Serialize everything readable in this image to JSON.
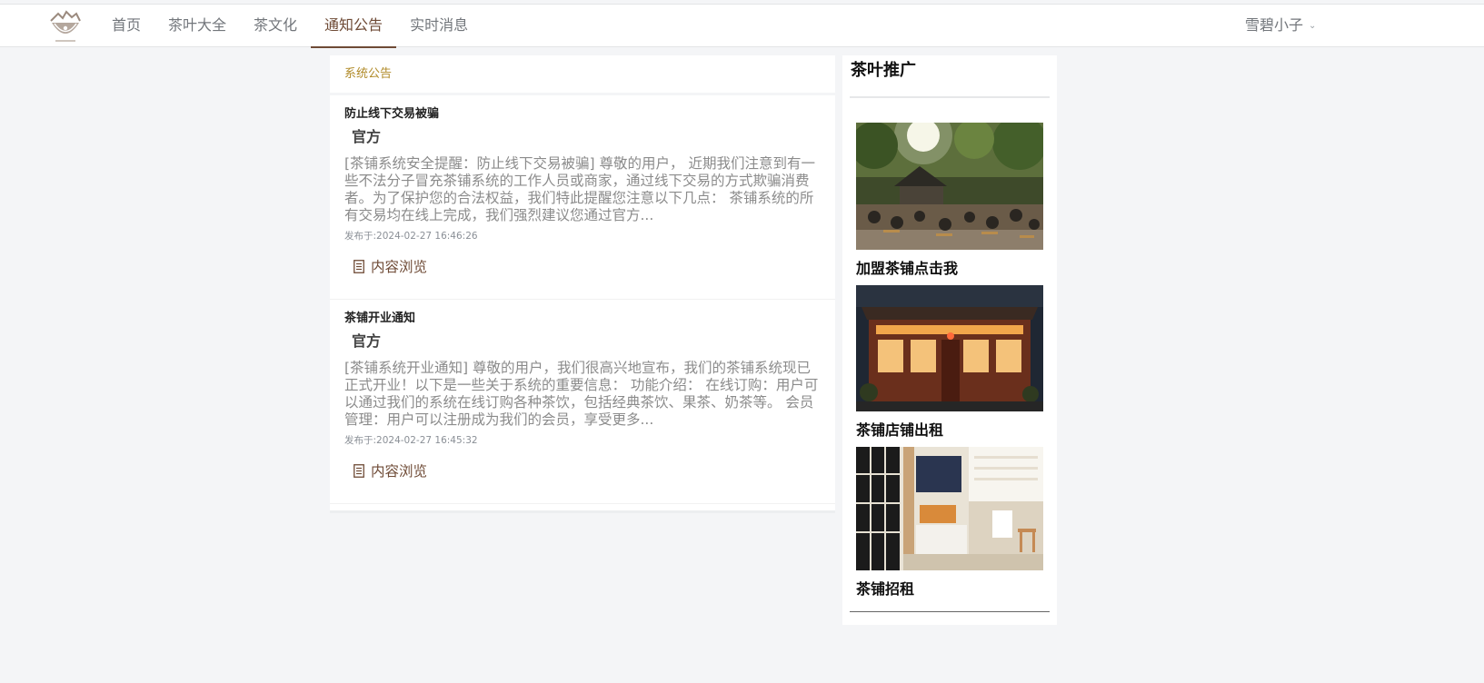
{
  "nav": {
    "logo_icon": "tea-shop-logo-icon",
    "items": [
      {
        "label": "首页"
      },
      {
        "label": "茶叶大全"
      },
      {
        "label": "茶文化"
      },
      {
        "label": "通知公告",
        "active": true
      },
      {
        "label": "实时消息"
      }
    ],
    "user": {
      "name": "雪碧小子",
      "icon": "chevron-down-icon"
    }
  },
  "notices": {
    "header": "系统公告",
    "items": [
      {
        "title": "防止线下交易被骗",
        "author": "官方",
        "summary": "[茶铺系统安全提醒：防止线下交易被骗] 尊敬的用户， 近期我们注意到有一些不法分子冒充茶铺系统的工作人员或商家，通过线下交易的方式欺骗消费者。为了保护您的合法权益，我们特此提醒您注意以下几点： 茶铺系统的所有交易均在线上完成，我们强烈建议您通过官方...",
        "date": "发布于:2024-02-27 16:46:26",
        "view_label": "内容浏览"
      },
      {
        "title": "茶铺开业通知",
        "author": "官方",
        "summary": "[茶铺系统开业通知] 尊敬的用户，我们很高兴地宣布，我们的茶铺系统现已正式开业！以下是一些关于系统的重要信息： 功能介绍： 在线订购：用户可以通过我们的系统在线订购各种茶饮，包括经典茶饮、果茶、奶茶等。 会员管理：用户可以注册成为我们的会员，享受更多...",
        "date": "发布于:2024-02-27 16:45:32",
        "view_label": "内容浏览"
      }
    ]
  },
  "promo": {
    "title": "茶叶推广",
    "items": [
      {
        "name": "加盟茶铺点击我"
      },
      {
        "name": "茶铺店铺出租"
      },
      {
        "name": "茶铺招租"
      }
    ]
  },
  "colors": {
    "accent": "#6e4a35",
    "notice_header": "#b08a27",
    "nav_text": "#72767b",
    "page_bg": "#f4f5f7"
  }
}
